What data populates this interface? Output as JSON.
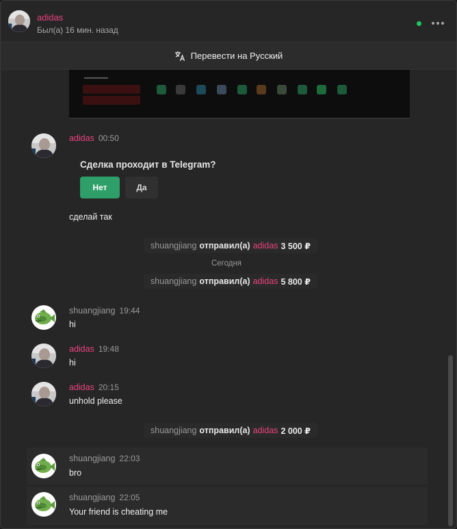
{
  "header": {
    "name": "adidas",
    "status": "Был(а) 16 мин. назад"
  },
  "translate": {
    "label": "Перевести на Русский"
  },
  "colors": {
    "accent": "#e8437e",
    "online": "#22c55e",
    "confirm": "#2e9f68"
  },
  "messages": {
    "m1": {
      "author": "adidas",
      "time": "00:50"
    },
    "deal": {
      "question": "Сделка проходит в Telegram?",
      "no": "Нет",
      "yes": "Да"
    },
    "m1_text": "сделай так",
    "m2": {
      "author": "shuangjiang",
      "time": "19:44",
      "text": "hi"
    },
    "m3": {
      "author": "adidas",
      "time": "19:48",
      "text": "hi"
    },
    "m4": {
      "author": "adidas",
      "time": "20:15",
      "text": "unhold please"
    },
    "m5": {
      "author": "shuangjiang",
      "time": "22:03",
      "text": "bro"
    },
    "m6": {
      "author": "shuangjiang",
      "time": "22:05",
      "text": "Your friend is cheating me"
    }
  },
  "system": {
    "s1": {
      "who": "shuangjiang",
      "action": "отправил(а)",
      "to": "adidas",
      "amount": "3 500 ₽"
    },
    "s2": {
      "who": "shuangjiang",
      "action": "отправил(а)",
      "to": "adidas",
      "amount": "5 800 ₽"
    },
    "s3": {
      "who": "shuangjiang",
      "action": "отправил(а)",
      "to": "adidas",
      "amount": "2 000 ₽"
    }
  },
  "date_separator": "Сегодня",
  "icons": {
    "translate": "translate-icon",
    "more": "more-dots-icon",
    "online": "online-status-dot"
  }
}
